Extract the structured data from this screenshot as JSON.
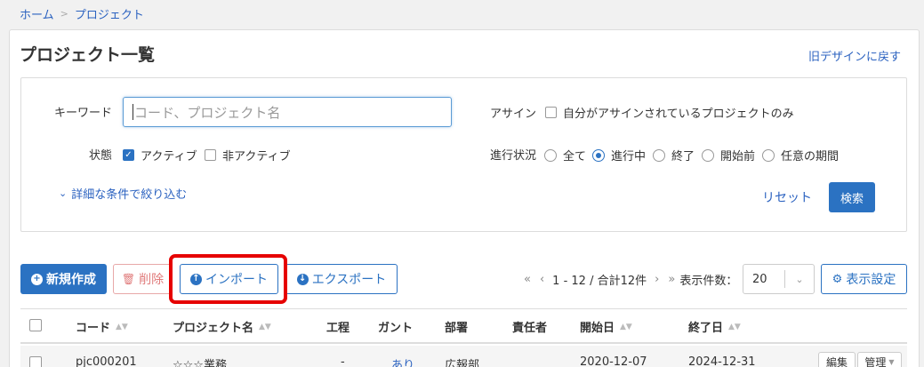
{
  "breadcrumb": {
    "home": "ホーム",
    "separator": ">",
    "current": "プロジェクト"
  },
  "page": {
    "title": "プロジェクト一覧",
    "old_design_link": "旧デザインに戻す"
  },
  "search": {
    "keyword_label": "キーワード",
    "keyword_placeholder": "コード、プロジェクト名",
    "keyword_value": "",
    "assign_label": "アサイン",
    "assign_option": {
      "label": "自分がアサインされているプロジェクトのみ",
      "checked": false
    },
    "status_label": "状態",
    "status_options": [
      {
        "label": "アクティブ",
        "checked": true
      },
      {
        "label": "非アクティブ",
        "checked": false
      }
    ],
    "progress_label": "進行状況",
    "progress_options": [
      {
        "label": "全て",
        "selected": false
      },
      {
        "label": "進行中",
        "selected": true
      },
      {
        "label": "終了",
        "selected": false
      },
      {
        "label": "開始前",
        "selected": false
      },
      {
        "label": "任意の期間",
        "selected": false
      }
    ],
    "detail_link": "詳細な条件で絞り込む",
    "reset_label": "リセット",
    "search_button": "検索"
  },
  "toolbar": {
    "new_button": "新規作成",
    "delete_button": "削除",
    "import_button": "インポート",
    "export_button": "エクスポート",
    "pager_text": "1 - 12 / 合計12件",
    "per_page_label": "表示件数：",
    "per_page_value": "20",
    "display_settings": "表示設定"
  },
  "table": {
    "columns": [
      "コード",
      "プロジェクト名",
      "工程",
      "ガント",
      "部署",
      "責任者",
      "開始日",
      "終了日"
    ],
    "rows": [
      {
        "code": "pjc000201",
        "name": "☆☆☆業務",
        "process": "-",
        "gantt": "あり",
        "department": "広報部",
        "owner": "",
        "start": "2020-12-07",
        "end": "2024-12-31",
        "edit_label": "編集",
        "manage_label": "管理"
      }
    ]
  },
  "colors": {
    "accent": "#2b72c2",
    "link": "#2b62c0",
    "danger": "#e07b7b",
    "highlight": "#e60000"
  }
}
